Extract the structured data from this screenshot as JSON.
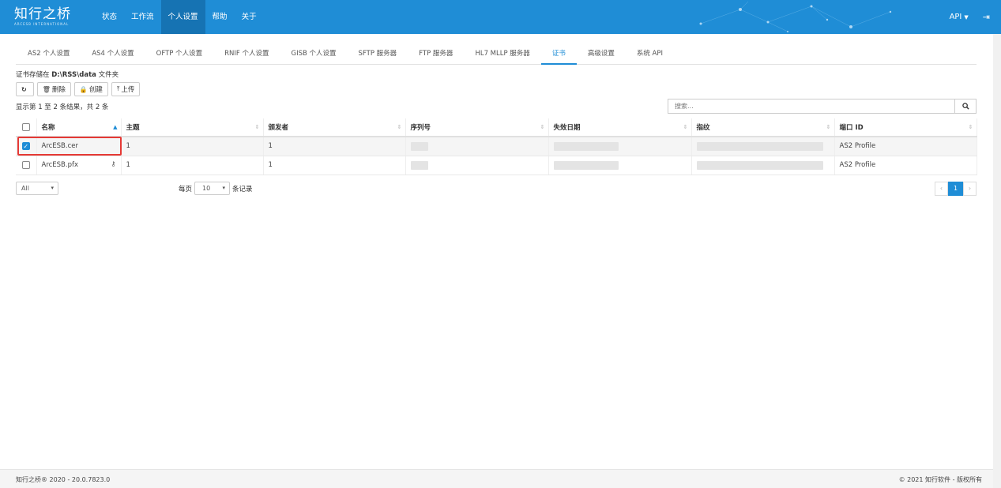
{
  "brand": {
    "name": "知行之桥",
    "tagline": "ARCESB INTERNATIONAL"
  },
  "nav": {
    "items": [
      {
        "label": "状态",
        "active": false
      },
      {
        "label": "工作流",
        "active": false
      },
      {
        "label": "个人设置",
        "active": true
      },
      {
        "label": "帮助",
        "active": false
      },
      {
        "label": "关于",
        "active": false
      }
    ],
    "api_label": "API",
    "logout_icon": "sign-out-icon"
  },
  "tabs": [
    {
      "label": "AS2 个人设置",
      "active": false
    },
    {
      "label": "AS4 个人设置",
      "active": false
    },
    {
      "label": "OFTP 个人设置",
      "active": false
    },
    {
      "label": "RNIF 个人设置",
      "active": false
    },
    {
      "label": "GISB 个人设置",
      "active": false
    },
    {
      "label": "SFTP 服务器",
      "active": false
    },
    {
      "label": "FTP 服务器",
      "active": false
    },
    {
      "label": "HL7 MLLP 服务器",
      "active": false
    },
    {
      "label": "证书",
      "active": true
    },
    {
      "label": "高级设置",
      "active": false
    },
    {
      "label": "系统 API",
      "active": false
    }
  ],
  "store_note": {
    "prefix": "证书存储在 ",
    "path": "D:\\RSS\\data",
    "suffix": " 文件夹"
  },
  "toolbar": {
    "refresh_icon": "refresh-icon",
    "delete_label": "删除",
    "create_label": "创建",
    "upload_label": "上传"
  },
  "count_text": "显示第 1 至 2 条结果，共 2 条",
  "search": {
    "placeholder": "搜索..."
  },
  "table": {
    "columns": [
      "名称",
      "主题",
      "颁发者",
      "序列号",
      "失效日期",
      "指纹",
      "端口 ID"
    ],
    "rows": [
      {
        "checked": true,
        "name": "ArcESB.cer",
        "subject": "1",
        "issuer": "1",
        "port_id": "AS2 Profile",
        "has_key": false
      },
      {
        "checked": false,
        "name": "ArcESB.pfx",
        "subject": "1",
        "issuer": "1",
        "port_id": "AS2 Profile",
        "has_key": true
      }
    ]
  },
  "filter": {
    "selected": "All"
  },
  "paging": {
    "prefix": "每页",
    "size": "10",
    "suffix": "条记录",
    "current": "1",
    "prev": "‹",
    "next": "›"
  },
  "footer": {
    "left": "知行之桥® 2020 - 20.0.7823.0",
    "right": "© 2021 知行软件 - 版权所有"
  },
  "colors": {
    "primary": "#1f8dd6",
    "nav_active": "#1673b3",
    "highlight": "#e53935"
  }
}
